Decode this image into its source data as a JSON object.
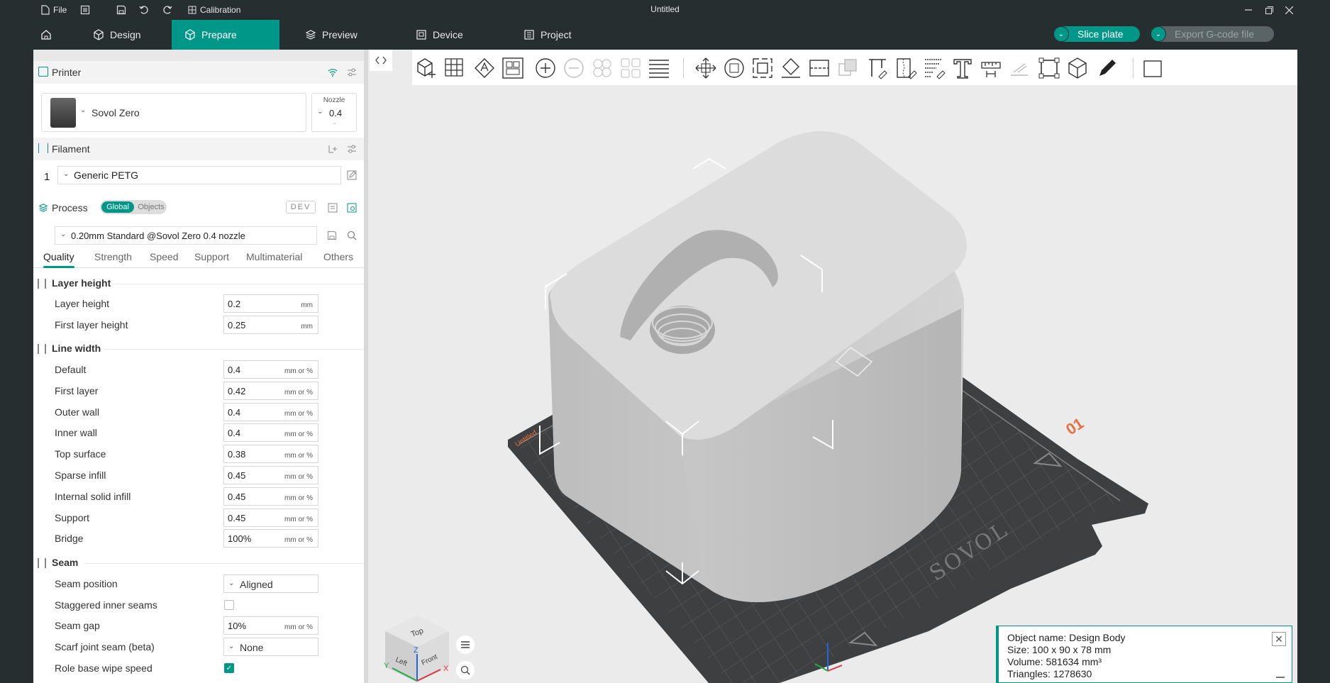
{
  "titlebar": {
    "file_label": "File",
    "calibration_label": "Calibration",
    "title": "Untitled"
  },
  "tabs": [
    {
      "label": "Design"
    },
    {
      "label": "Prepare"
    },
    {
      "label": "Preview"
    },
    {
      "label": "Device"
    },
    {
      "label": "Project"
    }
  ],
  "actions": {
    "slice_label": "Slice plate",
    "export_label": "Export G-code file"
  },
  "printer": {
    "header": "Printer",
    "name": "Sovol Zero",
    "nozzle_label": "Nozzle",
    "nozzle_value": "0.4",
    "nozzle_sub": "-"
  },
  "filament": {
    "header": "Filament",
    "index": "1",
    "name": "Generic PETG"
  },
  "process": {
    "header": "Process",
    "toggle_global": "Global",
    "toggle_objects": "Objects",
    "dev_badge": "DEV",
    "preset": "0.20mm Standard @Sovol Zero 0.4 nozzle"
  },
  "subtabs": [
    "Quality",
    "Strength",
    "Speed",
    "Support",
    "Multimaterial",
    "Others"
  ],
  "groups": {
    "layer_height": "Layer height",
    "line_width": "Line width",
    "seam": "Seam"
  },
  "layer_rows": [
    {
      "label": "Layer height",
      "value": "0.2",
      "unit": "mm"
    },
    {
      "label": "First layer height",
      "value": "0.25",
      "unit": "mm"
    }
  ],
  "line_rows": [
    {
      "label": "Default",
      "value": "0.4",
      "unit": "mm or %"
    },
    {
      "label": "First layer",
      "value": "0.42",
      "unit": "mm or %"
    },
    {
      "label": "Outer wall",
      "value": "0.4",
      "unit": "mm or %"
    },
    {
      "label": "Inner wall",
      "value": "0.4",
      "unit": "mm or %"
    },
    {
      "label": "Top surface",
      "value": "0.38",
      "unit": "mm or %"
    },
    {
      "label": "Sparse infill",
      "value": "0.45",
      "unit": "mm or %"
    },
    {
      "label": "Internal solid infill",
      "value": "0.45",
      "unit": "mm or %"
    },
    {
      "label": "Support",
      "value": "0.45",
      "unit": "mm or %"
    },
    {
      "label": "Bridge",
      "value": "100%",
      "unit": "mm or %"
    }
  ],
  "seam_rows": {
    "position_label": "Seam position",
    "position_value": "Aligned",
    "staggered_label": "Staggered inner seams",
    "staggered_checked": false,
    "gap_label": "Seam gap",
    "gap_value": "10%",
    "gap_unit": "mm or %",
    "scarf_label": "Scarf joint seam (beta)",
    "scarf_value": "None",
    "wipe_label": "Role base wipe speed",
    "wipe_checked": true
  },
  "plate": {
    "brand": "SOVOL",
    "plate_label": "Untitled",
    "plate_number": "01"
  },
  "navcube": {
    "top": "Top",
    "left": "Left",
    "front": "Front",
    "x": "X",
    "y": "Y",
    "z": "Z"
  },
  "object_info": {
    "name": "Object name: Design Body",
    "size": "Size: 100 x 90 x 78 mm",
    "volume": "Volume: 581634 mm³",
    "triangles": "Triangles: 1278630"
  },
  "colors": {
    "accent": "#009688",
    "dark": "#262e30",
    "plate": "#3d3f40"
  }
}
